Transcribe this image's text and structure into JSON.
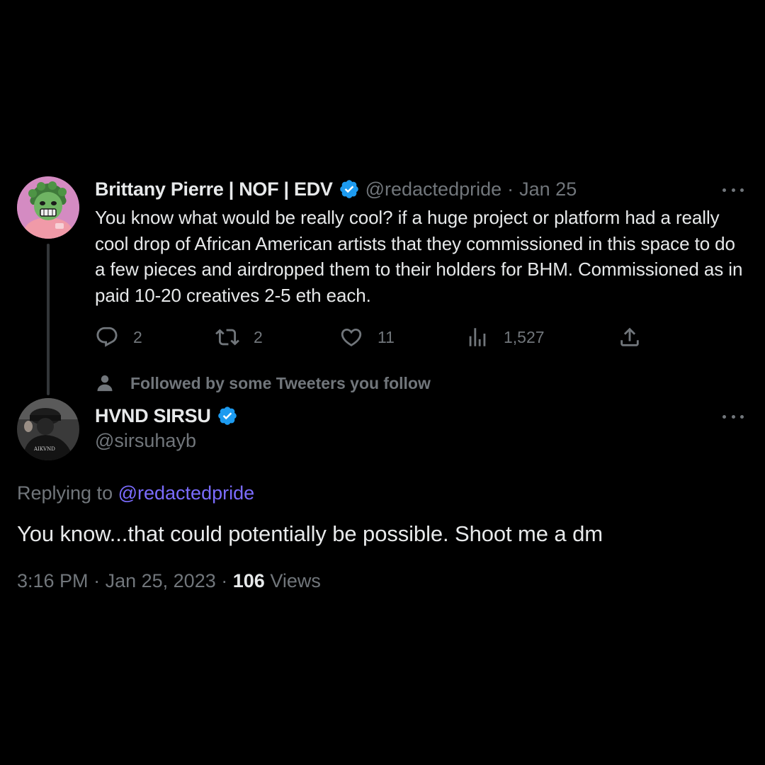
{
  "original_tweet": {
    "author_name": "Brittany Pierre | NOF | EDV",
    "handle": "@redactedpride",
    "separator": "·",
    "date": "Jan 25",
    "verified_icon": "verified-badge-icon",
    "text": "You know what would be really cool? if a huge project or platform had a really cool drop of African American artists that they commissioned in this space to do a few pieces and airdropped them to their holders for BHM. Commissioned as in paid 10-20 creatives 2-5 eth each.",
    "actions": {
      "replies": "2",
      "retweets": "2",
      "likes": "11",
      "views": "1,527"
    }
  },
  "social_context": {
    "text": "Followed by some Tweeters you follow",
    "icon": "person-icon"
  },
  "reply_tweet": {
    "author_name": "HVND SIRSU",
    "handle": "@sirsuhayb",
    "replying_label": "Replying to",
    "replying_to": "@redactedpride",
    "text": "You know...that could potentially be possible. Shoot me a dm",
    "time": "3:16 PM",
    "date": "Jan 25, 2023",
    "separator": "·",
    "views_count": "106",
    "views_label": "Views"
  },
  "colors": {
    "background": "#000000",
    "text_primary": "#e7e9ea",
    "text_secondary": "#71767b",
    "verified": "#1d9bf0",
    "mention": "#7b6cff"
  }
}
